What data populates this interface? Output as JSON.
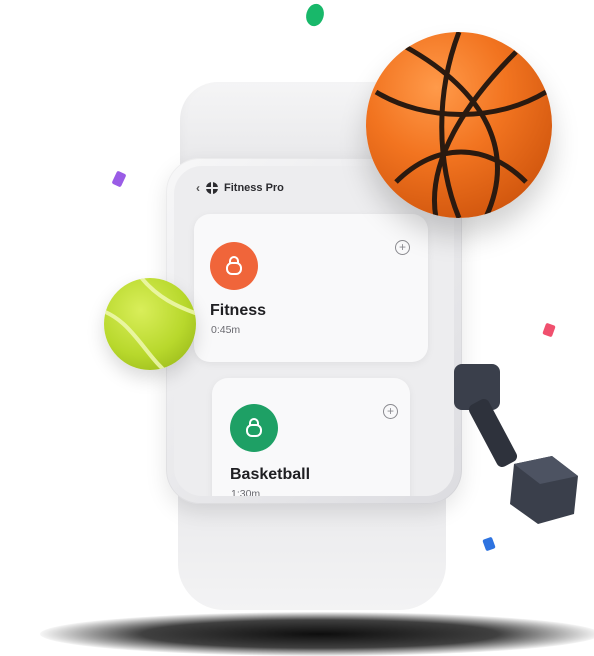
{
  "app": {
    "title": "Fitness Pro",
    "logo_icon": "basketball-logo-icon",
    "back_icon": "chevron-left-icon"
  },
  "activities": [
    {
      "title": "Fitness",
      "time": "0:45m",
      "icon": "kettlebell-icon",
      "icon_color": "#F0653A",
      "action_icon": "plus-circle-icon"
    },
    {
      "title": "Basketball",
      "time": "1:30m",
      "icon": "kettlebell-icon",
      "icon_color": "#1EA065",
      "action_icon": "plus-circle-icon"
    }
  ],
  "decorations": {
    "objects": [
      "basketball",
      "tennis-ball",
      "dumbbell",
      "confetti"
    ],
    "basketball_color": "#F27420",
    "tennis_ball_color": "#B8D82C",
    "dumbbell_color": "#3A3F4B"
  }
}
